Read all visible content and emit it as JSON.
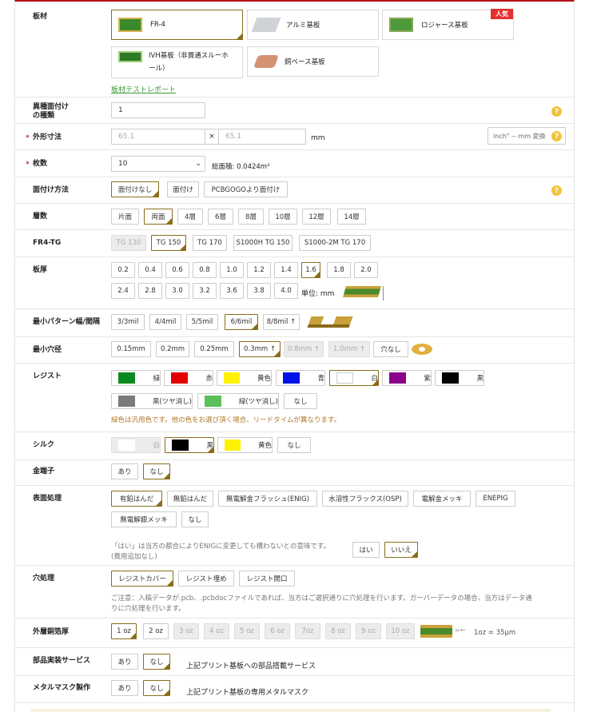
{
  "material": {
    "label": "板材",
    "items": [
      "FR-4",
      "アルミ基板",
      "ロジャース基板",
      "IVH基板（非貫通スルーホール）",
      "銅ベース基板"
    ],
    "line2": "ール）",
    "popular_badge": "人気",
    "report_link": "板材テストレポート"
  },
  "types": {
    "label1": "異種面付け",
    "label2": "の種類",
    "value": "1"
  },
  "size": {
    "label": "外形寸法",
    "req": "*",
    "w": "65.1",
    "x": "×",
    "h": "65.1",
    "unit": "mm",
    "convert": "inch\" -- mm 変換"
  },
  "qty": {
    "label": "枚数",
    "req": "*",
    "value": "10",
    "area": "総面積: 0.0424m²"
  },
  "panel": {
    "label": "面付け方法",
    "options": [
      "面付けなし",
      "面付け",
      "PCBGOGOより面付け"
    ]
  },
  "layers": {
    "label": "層数",
    "options": [
      "片面",
      "両面",
      "4層",
      "6層",
      "8層",
      "10層",
      "12層",
      "14層"
    ]
  },
  "tg": {
    "label": "FR4-TG",
    "options": [
      "TG 130",
      "TG 150",
      "TG 170",
      "S1000H TG 150",
      "S1000-2M TG 170"
    ]
  },
  "thick": {
    "label": "板厚",
    "row1": [
      "0.2",
      "0.4",
      "0.6",
      "0.8",
      "1.0",
      "1.2",
      "1.4",
      "1.6",
      "1.8",
      "2.0"
    ],
    "row2": [
      "2.4",
      "2.8",
      "3.0",
      "3.2",
      "3.6",
      "3.8",
      "4.0"
    ],
    "unit": "単位: mm"
  },
  "trace": {
    "label": "最小パターン幅/間隔",
    "options": [
      "3/3mil",
      "4/4mil",
      "5/5mil",
      "6/6mil",
      "8/8mil ↑"
    ]
  },
  "hole": {
    "label": "最小穴径",
    "options": [
      "0.15mm",
      "0.2mm",
      "0.25mm",
      "0.3mm ↑",
      "0.8mm ↑",
      "1.0mm ↑",
      "穴なし"
    ]
  },
  "resist": {
    "label": "レジスト",
    "row1": [
      "緑",
      "赤",
      "黄色",
      "青",
      "白",
      "紫",
      "黒"
    ],
    "row2": [
      "黒(ツヤ消し)",
      "緑(ツヤ消し)",
      "なし"
    ],
    "colors": [
      "#0a8a1e",
      "#e30000",
      "#fff200",
      "#0012e6",
      "#ffffff",
      "#8a008a",
      "#000000",
      "#7a7a7a",
      "#5bbf5b"
    ],
    "note": "緑色は汎用色です。他の色をお選び頂く場合、リードタイムが異なります。"
  },
  "silk": {
    "label": "シルク",
    "options": [
      "白",
      "黒",
      "黄色",
      "なし"
    ],
    "colors": [
      "#ffffff",
      "#000000",
      "#fff200"
    ]
  },
  "gold": {
    "label": "金端子",
    "options": [
      "あり",
      "なし"
    ]
  },
  "surface": {
    "label": "表面処理",
    "row1": [
      "有鉛はんだ",
      "無鉛はんだ",
      "無電解金フラッシュ(ENIG)",
      "水溶性フラックス(OSP)",
      "電解金メッキ",
      "ENEPIG"
    ],
    "row2": [
      "無電解銀メッキ",
      "なし"
    ],
    "note1": "「はい」は当方の都合によりENIGに変更しても構わないとの意味です。",
    "note2": "(費用追加なし)",
    "yes": "はい",
    "no": "いいえ"
  },
  "via": {
    "label": "穴処理",
    "options": [
      "レジストカバー",
      "レジスト埋め",
      "レジスト開口"
    ],
    "note1": "ご注意：入稿データが.pcb、.pcbdocファイルであれば、当方はご選択通りに穴処理を行います。ガーバーデータの場合、当方はデータ通",
    "note2": "りに穴処理を行います。"
  },
  "copper": {
    "label": "外層銅箔厚",
    "options": [
      "1 oz",
      "2 oz",
      "3 oz",
      "4 oz",
      "5 oz",
      "6 oz",
      "7oz",
      "8 oz",
      "9 oz",
      "10 oz"
    ],
    "unit": "1oz = 35μm"
  },
  "assembly": {
    "label": "部品実装サービス",
    "options": [
      "あり",
      "なし"
    ],
    "desc": "上記プリント基板への部品搭載サービス"
  },
  "stencil": {
    "label": "メタルマスク製作",
    "options": [
      "あり",
      "なし"
    ],
    "desc": "上記プリント基板の専用メタルマスク"
  }
}
